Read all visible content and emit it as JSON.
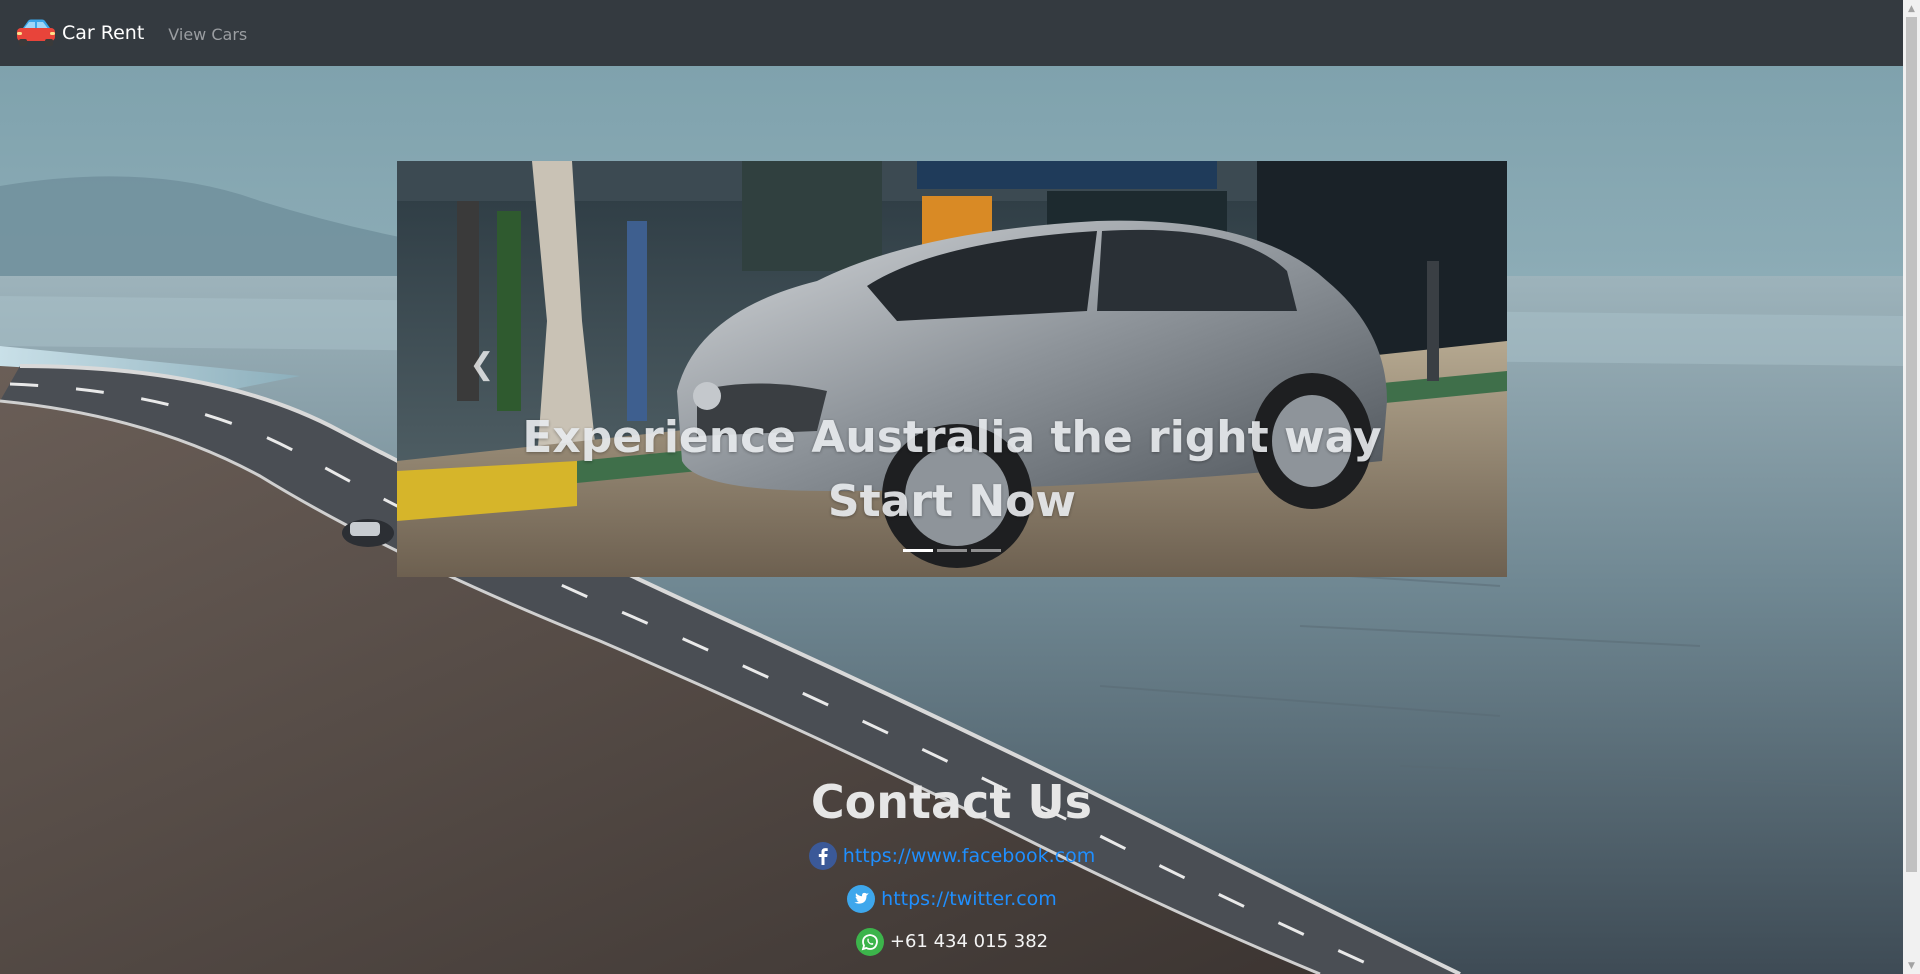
{
  "navbar": {
    "brand": "Car Rent",
    "view_cars": "View Cars",
    "brand_icon": "red-car-icon"
  },
  "carousel": {
    "caption_line1": "Experience Australia the right way",
    "caption_line2": "Start Now",
    "prev_icon": "chevron-left-icon",
    "indicators": 3,
    "active_indicator": 0
  },
  "contact": {
    "title": "Contact Us",
    "facebook": "https://www.facebook.com",
    "twitter": "https://twitter.com",
    "whatsapp": "+61 434 015 382"
  },
  "colors": {
    "navbar_bg": "#343a40",
    "link": "#1f8fff",
    "brand": "#ffffff",
    "nav_muted": "#9a9da1"
  }
}
